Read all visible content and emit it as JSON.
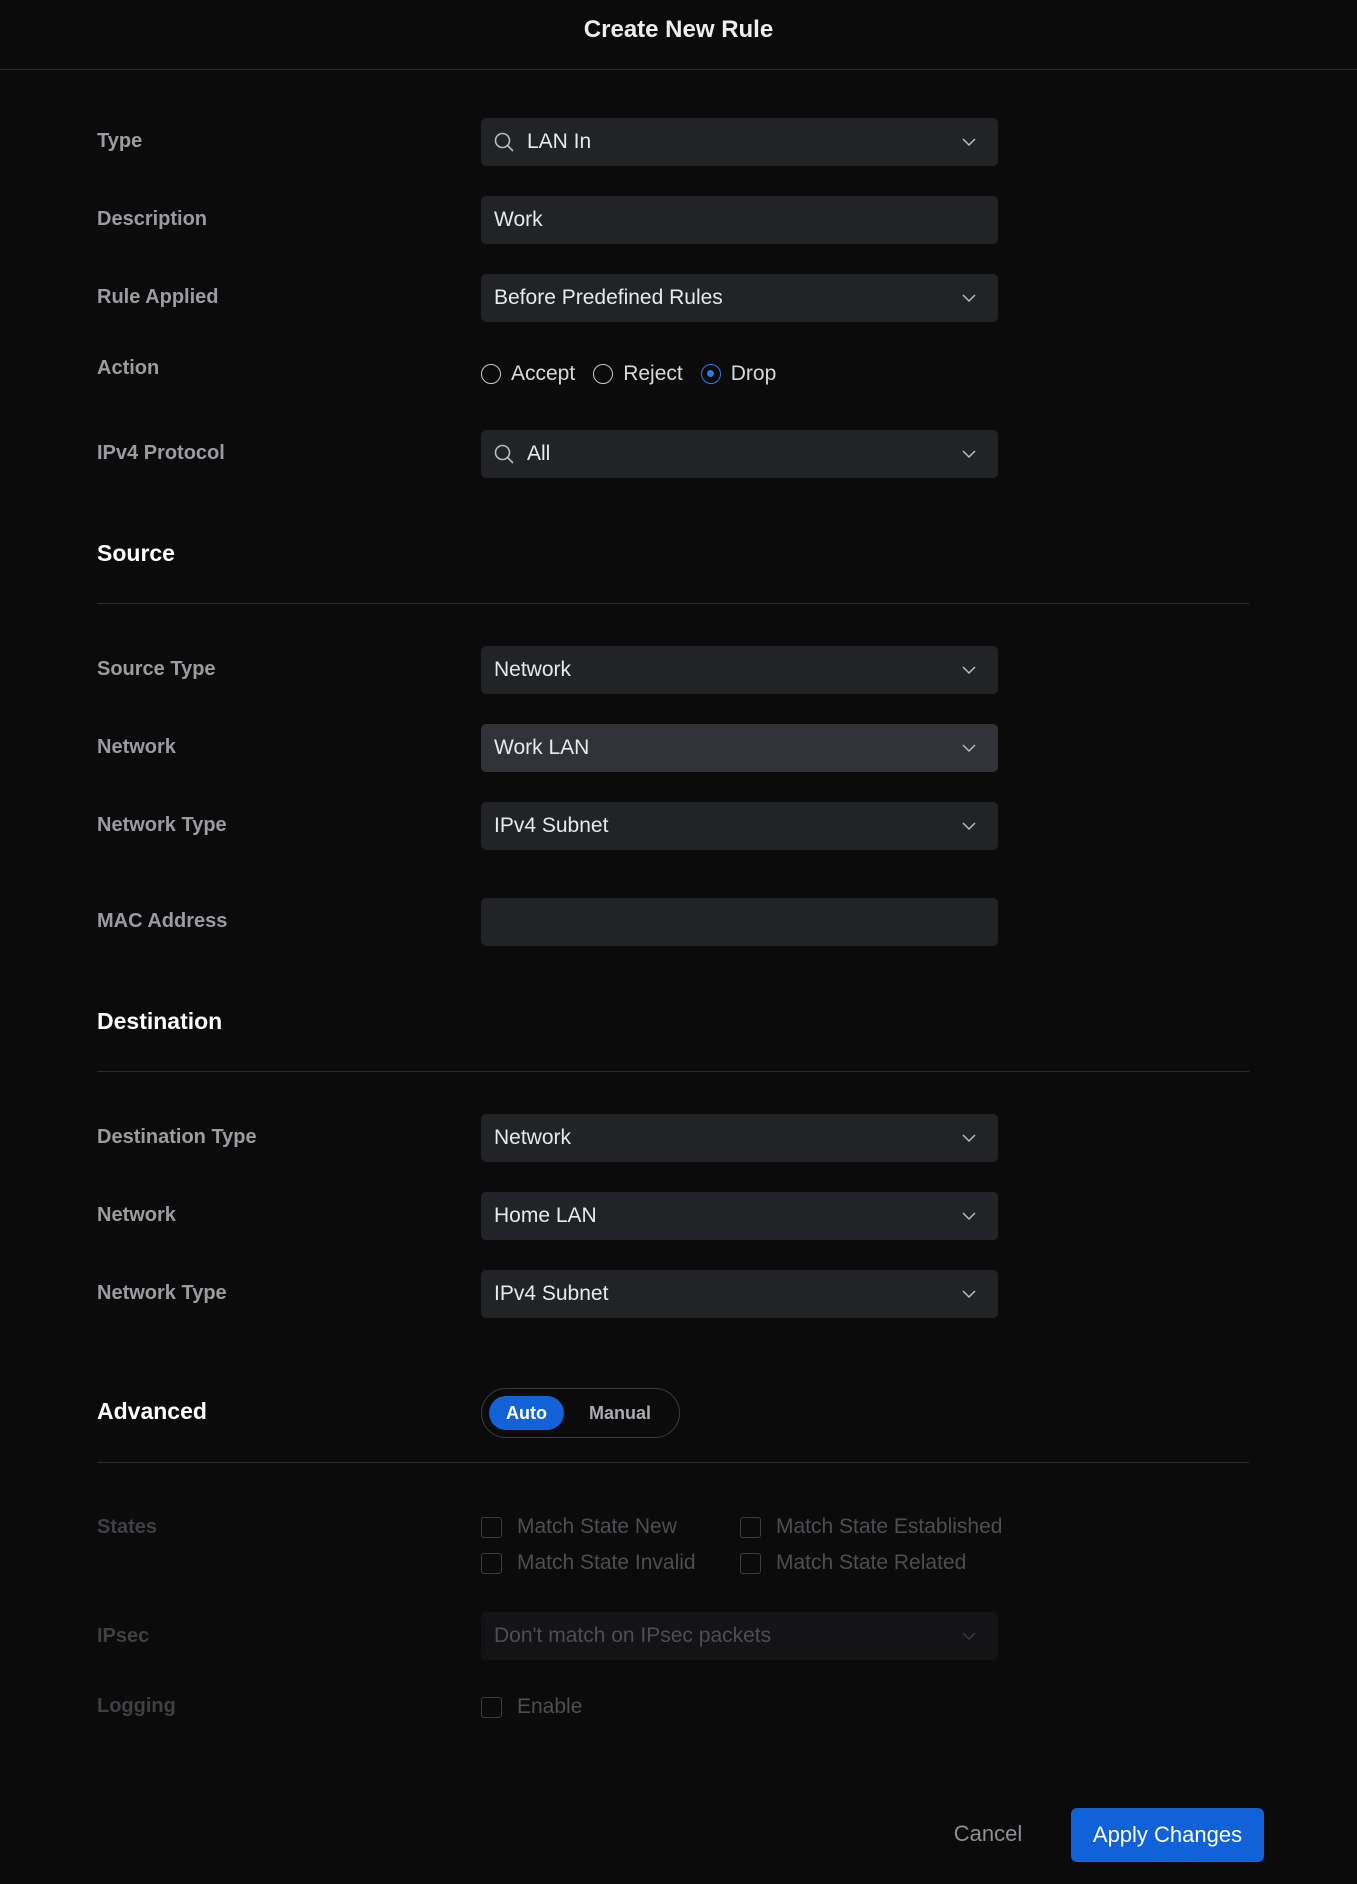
{
  "dialog": {
    "title": "Create New Rule"
  },
  "general": {
    "type_label": "Type",
    "type_value": "LAN In",
    "description_label": "Description",
    "description_value": "Work",
    "rule_applied_label": "Rule Applied",
    "rule_applied_value": "Before Predefined Rules",
    "action_label": "Action",
    "action_options": [
      "Accept",
      "Reject",
      "Drop"
    ],
    "action_selected": "Drop",
    "protocol_label": "IPv4 Protocol",
    "protocol_value": "All"
  },
  "source": {
    "heading": "Source",
    "type_label": "Source Type",
    "type_value": "Network",
    "network_label": "Network",
    "network_value": "Work LAN",
    "network_type_label": "Network Type",
    "network_type_value": "IPv4 Subnet",
    "mac_label": "MAC Address",
    "mac_value": ""
  },
  "destination": {
    "heading": "Destination",
    "type_label": "Destination Type",
    "type_value": "Network",
    "network_label": "Network",
    "network_value": "Home LAN",
    "network_type_label": "Network Type",
    "network_type_value": "IPv4 Subnet"
  },
  "advanced": {
    "heading": "Advanced",
    "mode_options": [
      "Auto",
      "Manual"
    ],
    "mode_selected": "Auto",
    "states_label": "States",
    "states": [
      "Match State New",
      "Match State Established",
      "Match State Invalid",
      "Match State Related"
    ],
    "ipsec_label": "IPsec",
    "ipsec_value": "Don't match on IPsec packets",
    "logging_label": "Logging",
    "logging_option": "Enable"
  },
  "footer": {
    "cancel_label": "Cancel",
    "apply_label": "Apply Changes"
  },
  "colors": {
    "accent": "#1162d9",
    "background": "#0b0b0c",
    "field": "#222327"
  }
}
